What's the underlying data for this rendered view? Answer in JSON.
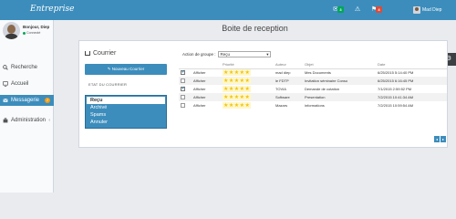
{
  "app": {
    "logo": "Entreprise"
  },
  "topbar": {
    "notifications": [
      {
        "icon": "envelope-icon",
        "count": "3",
        "color": "#00a65a"
      },
      {
        "icon": "warning-icon",
        "count": "",
        "color": ""
      },
      {
        "icon": "flag-icon",
        "count": "4",
        "color": "#dd4b39"
      }
    ],
    "user_label": "Mad Diep"
  },
  "sidebar": {
    "user_name": "Bonjour, Diep",
    "status": "Connecté",
    "items": [
      {
        "label": "Recherche",
        "icon": "search-icon"
      },
      {
        "label": "Accueil",
        "icon": "desktop-icon"
      },
      {
        "label": "Messagerie",
        "icon": "mail-icon",
        "badge": "2"
      },
      {
        "label": "Administration",
        "icon": "briefcase-icon"
      }
    ]
  },
  "page": {
    "title": "Boite de reception"
  },
  "courrier": {
    "title": "Courrier",
    "new_button": "Nouveau Courrier",
    "etat_label": "ETAT DU COURRIER",
    "folders": [
      "Reçu",
      "Archivé",
      "Spams",
      "Annuler"
    ]
  },
  "group_action": {
    "label": "Action de groupe :",
    "value": "Reçu"
  },
  "table": {
    "headers": [
      "",
      "",
      "Priorité",
      "Auteur",
      "Objet",
      "Date"
    ],
    "rows": [
      {
        "checked": true,
        "action": "Afficher",
        "stars": "★★★★★",
        "author": "mad diep",
        "subject": "Mes Documents",
        "date": "6/25/2015 5:14:40 PM"
      },
      {
        "checked": false,
        "action": "Afficher",
        "stars": "★★★★★",
        "author": "le FDTP",
        "subject": "Invitation séminaire Conso",
        "date": "6/25/2015 6:16:45 PM"
      },
      {
        "checked": true,
        "action": "Afficher",
        "stars": "★★★★★",
        "author": "TOVIA",
        "subject": "Demande de cotation",
        "date": "7/1/2015 2:59:52 PM"
      },
      {
        "checked": false,
        "action": "Afficher",
        "stars": "★★★★★",
        "author": "Software",
        "subject": "Presentation",
        "date": "7/2/2015 10:41:34 AM"
      },
      {
        "checked": false,
        "action": "Afficher",
        "stars": "★★★★★",
        "author": "Mazars",
        "subject": "informations",
        "date": "7/2/2015 10:59:54 AM"
      }
    ]
  },
  "pager": {
    "prev": "◂",
    "next": "▸"
  },
  "settings": {
    "icon": "gear-icon"
  }
}
